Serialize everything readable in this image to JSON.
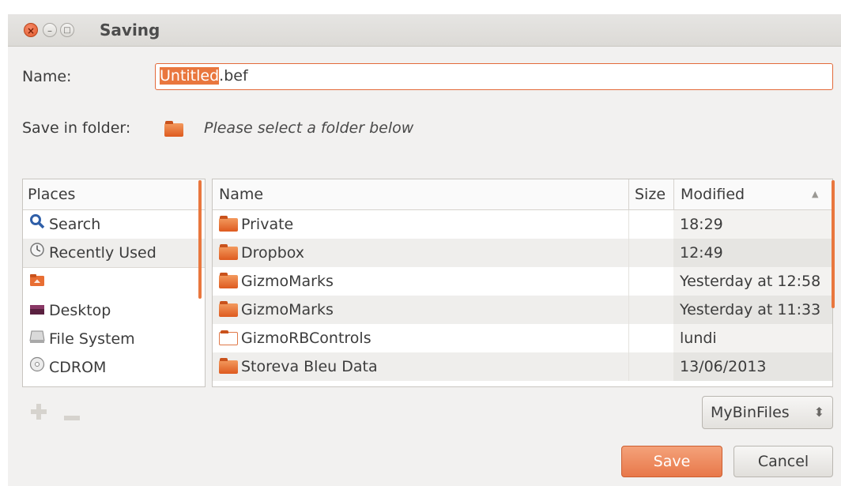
{
  "window": {
    "title": "Saving"
  },
  "name_field": {
    "label": "Name:",
    "selected_part": "Untitled",
    "rest": ".bef"
  },
  "save_in": {
    "label": "Save in folder:",
    "hint": "Please select a folder below"
  },
  "places": {
    "header": "Places",
    "items": [
      {
        "label": "Search",
        "icon": "search-icon"
      },
      {
        "label": "Recently Used",
        "icon": "clock-icon"
      },
      {
        "label": "",
        "icon": "home-folder-icon"
      },
      {
        "label": "Desktop",
        "icon": "desktop-icon"
      },
      {
        "label": "File System",
        "icon": "drive-icon"
      },
      {
        "label": "CDROM",
        "icon": "cdrom-icon"
      }
    ]
  },
  "files": {
    "columns": {
      "name": "Name",
      "size": "Size",
      "modified": "Modified"
    },
    "sort_indicator": "▲",
    "rows": [
      {
        "name": "Private",
        "modified": "18:29"
      },
      {
        "name": "Dropbox",
        "modified": "12:49"
      },
      {
        "name": "GizmoMarks",
        "modified": "Yesterday at 12:58"
      },
      {
        "name": "GizmoMarks",
        "modified": "Yesterday at 11:33"
      },
      {
        "name": "GizmoRBControls",
        "modified": "lundi"
      },
      {
        "name": "Storeva Bleu Data",
        "modified": "13/06/2013"
      }
    ]
  },
  "filter": {
    "value": "MyBinFiles",
    "spinner": "⬍"
  },
  "buttons": {
    "save": "Save",
    "cancel": "Cancel"
  },
  "colors": {
    "accent": "#e9773e",
    "window_bg": "#f2f1f0"
  }
}
